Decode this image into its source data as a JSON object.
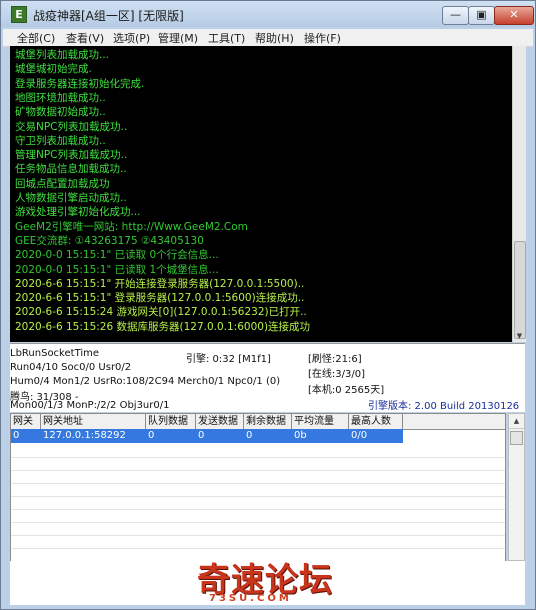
{
  "window": {
    "app_icon_letter": "E",
    "title": "战疫神器[A组一区] [无限版]",
    "buttons": {
      "minimize": "—",
      "maximize": "▣",
      "close": "✕"
    }
  },
  "menu": [
    "全部(C)",
    "查看(V)",
    "选项(P)",
    "管理(M)",
    "工具(T)",
    "帮助(H)",
    "操作(F)"
  ],
  "console": {
    "lines": [
      {
        "text": "城堡列表加载成功...",
        "color": "#3ee03e"
      },
      {
        "text": "城堡城初始完成.",
        "color": "#3ee03e"
      },
      {
        "text": "登录服务器连接初始化完成.",
        "color": "#3ee03e"
      },
      {
        "text": "地图环境加载成功..",
        "color": "#3ee03e"
      },
      {
        "text": "矿物数据初始成功..",
        "color": "#3ee03e"
      },
      {
        "text": "交易NPC列表加载成功..",
        "color": "#3ee03e"
      },
      {
        "text": "守卫列表加载成功..",
        "color": "#3ee03e"
      },
      {
        "text": "管理NPC列表加载成功..",
        "color": "#3ee03e"
      },
      {
        "text": "任务物品信息加载成功..",
        "color": "#3ee03e"
      },
      {
        "text": "回城点配置加载成功",
        "color": "#3ee03e"
      },
      {
        "text": "人物数据引擎启动成功..",
        "color": "#3ee03e"
      },
      {
        "text": "游戏处理引擎初始化成功...",
        "color": "#3ee03e"
      },
      {
        "text": "GeeM2引擎唯一网站: http://Www.GeeM2.Com",
        "color": "#32c832"
      },
      {
        "text": "GEE交流群: ①43263175   ②43405130",
        "color": "#32c832"
      },
      {
        "text": "2020-0-0 15:15:1\" 已读取 0个行会信息...",
        "color": "#32c832"
      },
      {
        "text": "2020-0-0 15:15:1\" 已读取 1个城堡信息...",
        "color": "#32c832"
      },
      {
        "text": "2020-6-6 15:15:1\" 开始连接登录服务器(127.0.0.1:5500)..",
        "color": "#b6ef4a"
      },
      {
        "text": "2020-6-6 15:15:1\" 登录服务器(127.0.0.1:5600)连接成功..",
        "color": "#b6ef4a"
      },
      {
        "text": "2020-6-6 15:15:24 游戏网关[0](127.0.0.1:56232)已打开..",
        "color": "#b6ef4a"
      },
      {
        "text": "2020-6-6 15:15:26 数据库服务器(127.0.0.1:6000)连接成功",
        "color": "#b6ef4a"
      }
    ]
  },
  "status": {
    "line1_left": "LbRunSocketTime",
    "engine": "引擎: 0:32 [M1f1]",
    "refresh": "[刷怪:21:6]",
    "line2_left": "Run04/10 Soc0/0 Usr0/2",
    "online": "[在线:3/3/0]",
    "line3_left": "Hum0/4 Mon1/2 UsrRo:108/2C94 Merch0/1 Npc0/1 (0)",
    "local": "[本机:0 2565天]",
    "line4_left": "腾鸟: 31/308 -",
    "version": "引擎版本: 2.00 Build 20130126",
    "line5_left": "Mon00/1/3 MonP:/2/2 Obj3ur0/1"
  },
  "grid": {
    "columns": [
      "网关",
      "网关地址",
      "队列数据",
      "发送数据",
      "剩余数据",
      "平均流量",
      "最高人数"
    ],
    "rows": [
      [
        "0",
        "127.0.0.1:58292",
        "0",
        "0",
        "0",
        "0b",
        "0/0"
      ]
    ]
  },
  "watermark": {
    "main": "奇速论坛",
    "sub": "73SU.COM"
  },
  "colors": {
    "console_bg": "#000000",
    "selected_row": "#3578e0",
    "watermark": "#c8341c"
  }
}
